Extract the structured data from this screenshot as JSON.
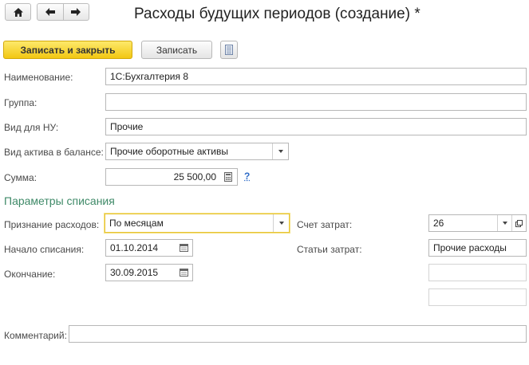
{
  "window": {
    "title": "Расходы будущих периодов (создание) *"
  },
  "toolbar": {
    "save_close_label": "Записать и закрыть",
    "save_label": "Записать"
  },
  "form": {
    "name": {
      "label": "Наименование:",
      "value": "1С:Бухгалтерия 8"
    },
    "group": {
      "label": "Группа:",
      "value": ""
    },
    "vid_nu": {
      "label": "Вид для НУ:",
      "value": "Прочие"
    },
    "asset_type": {
      "label": "Вид актива в балансе:",
      "value": "Прочие оборотные активы"
    },
    "amount": {
      "label": "Сумма:",
      "value": "25 500,00",
      "help": "?"
    }
  },
  "writeoff": {
    "section_title": "Параметры списания",
    "recognition": {
      "label": "Признание расходов:",
      "value": "По месяцам"
    },
    "start": {
      "label": "Начало списания:",
      "value": "01.10.2014"
    },
    "end": {
      "label": "Окончание:",
      "value": "30.09.2015"
    },
    "cost_account": {
      "label": "Счет затрат:",
      "value": "26"
    },
    "cost_items": {
      "label": "Статьи затрат:",
      "value": "Прочие расходы"
    },
    "extra1": {
      "value": ""
    },
    "extra2": {
      "value": ""
    }
  },
  "comment": {
    "label": "Комментарий:",
    "value": ""
  }
}
